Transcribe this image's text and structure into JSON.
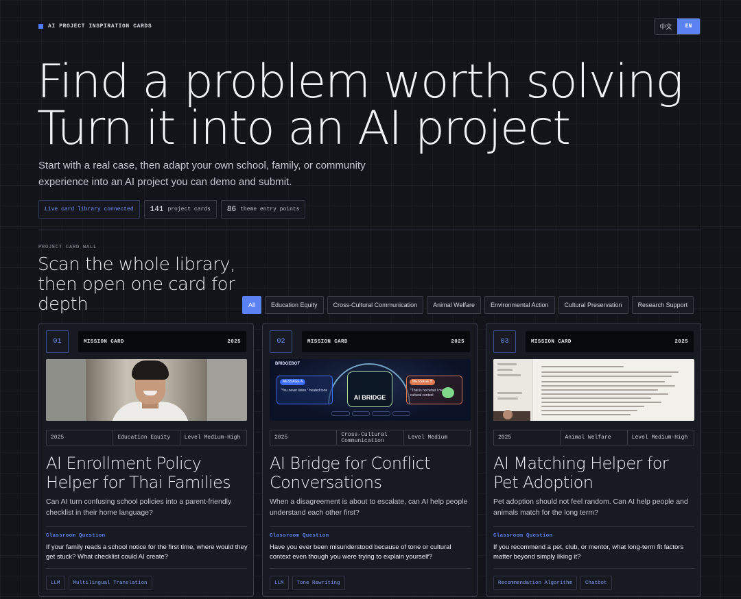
{
  "brand": {
    "title": "AI PROJECT INSPIRATION CARDS"
  },
  "lang": {
    "zh": "中文",
    "en": "EN"
  },
  "hero": {
    "line1": "Find a problem worth solving",
    "line2": "Turn it into an AI project",
    "subtitle": "Start with a real case, then adapt your own school, family, or community experience into an AI project you can demo and submit."
  },
  "stats": {
    "live": "Live card library connected",
    "cards_num": "141",
    "cards_label": "project cards",
    "themes_num": "86",
    "themes_label": "theme entry points"
  },
  "wall": {
    "label": "PROJECT CARD WALL",
    "title": "Scan the whole library, then open one card for depth"
  },
  "filters": [
    "All",
    "Education Equity",
    "Cross-Cultural Communication",
    "Animal Welfare",
    "Environmental Action",
    "Cultural Preservation",
    "Research Support"
  ],
  "cards": [
    {
      "num": "01",
      "head": "MISSION CARD",
      "year": "2025",
      "meta": [
        "2025",
        "Education Equity",
        "Level Medium-High"
      ],
      "title": "AI Enrollment Policy Helper for Thai Families",
      "desc": "Can AI turn confusing school policies into a parent-friendly checklist in their home language?",
      "q_label": "Classroom Question",
      "q_text": "If your family reads a school notice for the first time, where would they get stuck? What checklist could AI create?",
      "tags": [
        "LLM",
        "Multilingual Translation"
      ]
    },
    {
      "num": "02",
      "head": "MISSION CARD",
      "year": "2025",
      "meta": [
        "2025",
        "Cross-Cultural Communication",
        "Level Medium"
      ],
      "title": "AI Bridge for Conflict Conversations",
      "desc": "When a disagreement is about to escalate, can AI help people understand each other first?",
      "q_label": "Classroom Question",
      "q_text": "Have you ever been misunderstood because of tone or cultural context even though you were trying to explain yourself?",
      "tags": [
        "LLM",
        "Tone Rewriting"
      ],
      "image": {
        "app": "BRIDGEBOT",
        "msg_a": "MESSAGE A",
        "msg_a_text": "\"You never listen.\" heated tone",
        "core": "AI BRIDGE",
        "msg_b": "MESSAGE B",
        "msg_b_text": "\"That is not what I meant.\" cultural context"
      }
    },
    {
      "num": "03",
      "head": "MISSION CARD",
      "year": "2025",
      "meta": [
        "2025",
        "Animal Welfare",
        "Level Medium-High"
      ],
      "title": "AI Matching Helper for Pet Adoption",
      "desc": "Pet adoption should not feel random. Can AI help people and animals match for the long term?",
      "q_label": "Classroom Question",
      "q_text": "If you recommend a pet, club, or mentor, what long-term fit factors matter beyond simply liking it?",
      "tags": [
        "Recommendation Algorithm",
        "Chatbot"
      ]
    }
  ]
}
